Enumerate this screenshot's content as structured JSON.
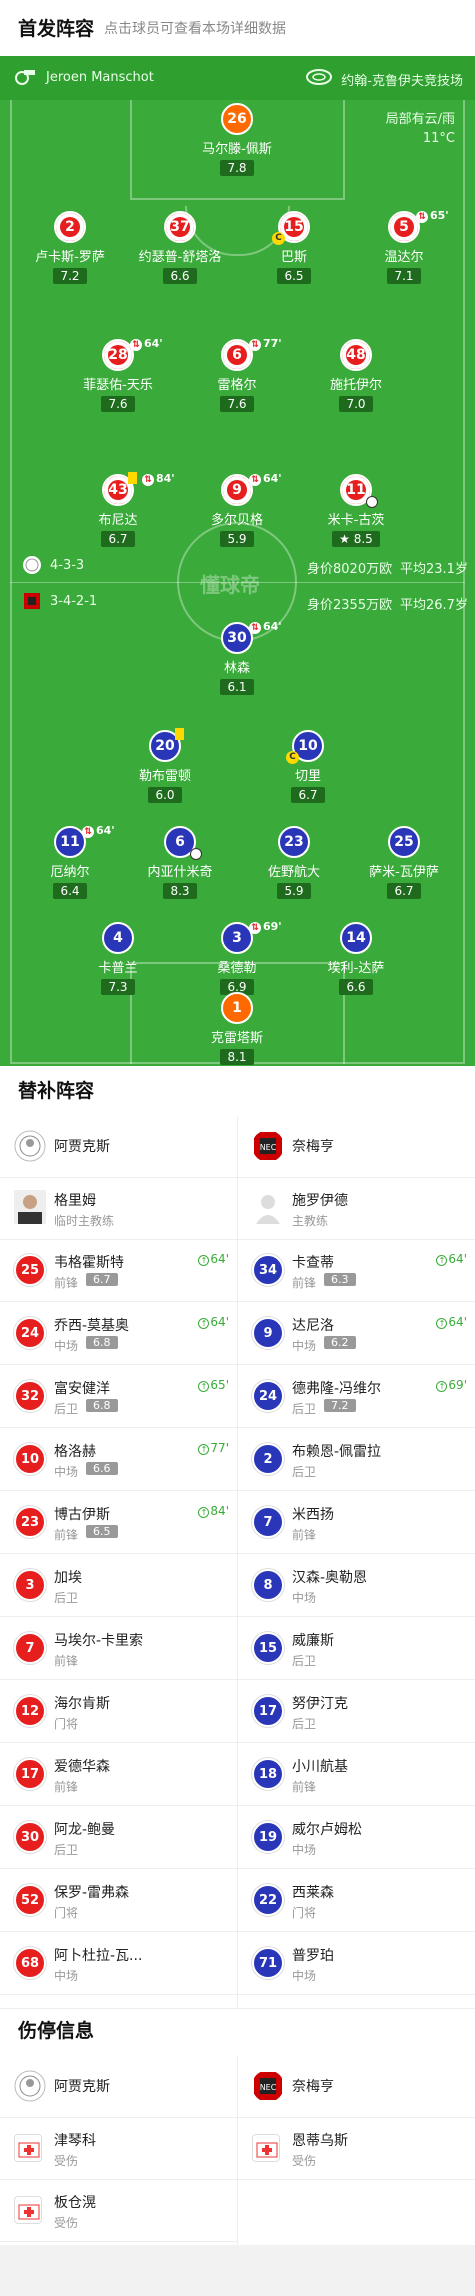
{
  "header": {
    "title": "首发阵容",
    "subtitle": "点击球员可查看本场详细数据"
  },
  "pitch": {
    "referee": "Jeroen Manschot",
    "venue": "约翰-克鲁伊夫竞技场",
    "weather": "局部有云/雨",
    "temperature": "11°C",
    "watermark": "懂球帝",
    "home": {
      "formation": "4-3-3",
      "value": "身价8020万欧",
      "age": "平均23.1岁"
    },
    "away": {
      "formation": "3-4-2-1",
      "value": "身价2355万欧",
      "age": "平均26.7岁"
    }
  },
  "home_players": [
    {
      "num": "26",
      "name": "马尔滕-佩斯",
      "rating": "7.8"
    },
    {
      "num": "2",
      "name": "卢卡斯-罗萨",
      "rating": "7.2"
    },
    {
      "num": "37",
      "name": "约瑟普-舒塔洛",
      "rating": "6.6"
    },
    {
      "num": "15",
      "name": "巴斯",
      "rating": "6.5"
    },
    {
      "num": "5",
      "name": "温达尔",
      "rating": "7.1",
      "sub": "65'"
    },
    {
      "num": "28",
      "name": "菲瑟佑-天乐",
      "rating": "7.6",
      "sub": "64'"
    },
    {
      "num": "6",
      "name": "雷格尔",
      "rating": "7.6",
      "sub": "77'"
    },
    {
      "num": "48",
      "name": "施托伊尔",
      "rating": "7.0"
    },
    {
      "num": "43",
      "name": "布尼达",
      "rating": "6.7",
      "sub": "84'"
    },
    {
      "num": "9",
      "name": "多尔贝格",
      "rating": "5.9",
      "sub": "64'"
    },
    {
      "num": "11",
      "name": "米卡-古茨",
      "rating": "8.5"
    }
  ],
  "away_players": [
    {
      "num": "30",
      "name": "林森",
      "rating": "6.1",
      "sub": "64'"
    },
    {
      "num": "20",
      "name": "勒布雷顿",
      "rating": "6.0"
    },
    {
      "num": "10",
      "name": "切里",
      "rating": "6.7"
    },
    {
      "num": "11",
      "name": "厄纳尔",
      "rating": "6.4",
      "sub": "64'"
    },
    {
      "num": "6",
      "name": "内亚什米奇",
      "rating": "8.3"
    },
    {
      "num": "23",
      "name": "佐野航大",
      "rating": "5.9"
    },
    {
      "num": "25",
      "name": "萨米-瓦伊萨",
      "rating": "6.7"
    },
    {
      "num": "4",
      "name": "卡普兰",
      "rating": "7.3"
    },
    {
      "num": "3",
      "name": "桑德勒",
      "rating": "6.9",
      "sub": "69'"
    },
    {
      "num": "14",
      "name": "埃利-达萨",
      "rating": "6.6"
    },
    {
      "num": "1",
      "name": "克雷塔斯",
      "rating": "8.1"
    }
  ],
  "subs": {
    "title": "替补阵容",
    "home_team": "阿贾克斯",
    "away_team": "奈梅亨",
    "home_coach": {
      "name": "格里姆",
      "role": "临时主教练"
    },
    "away_coach": {
      "name": "施罗伊德",
      "role": "主教练"
    },
    "home": [
      {
        "num": "25",
        "name": "韦格霍斯特",
        "pos": "前锋",
        "rating": "6.7",
        "sub": "64'"
      },
      {
        "num": "24",
        "name": "乔西-莫基奥",
        "pos": "中场",
        "rating": "6.8",
        "sub": "64'"
      },
      {
        "num": "32",
        "name": "富安健洋",
        "pos": "后卫",
        "rating": "6.8",
        "sub": "65'"
      },
      {
        "num": "10",
        "name": "格洛赫",
        "pos": "中场",
        "rating": "6.6",
        "sub": "77'"
      },
      {
        "num": "23",
        "name": "博古伊斯",
        "pos": "前锋",
        "rating": "6.5",
        "sub": "84'"
      },
      {
        "num": "3",
        "name": "加埃",
        "pos": "后卫"
      },
      {
        "num": "7",
        "name": "马埃尔-卡里索",
        "pos": "前锋"
      },
      {
        "num": "12",
        "name": "海尔肯斯",
        "pos": "门将"
      },
      {
        "num": "17",
        "name": "爱德华森",
        "pos": "前锋"
      },
      {
        "num": "30",
        "name": "阿龙-鲍曼",
        "pos": "后卫"
      },
      {
        "num": "52",
        "name": "保罗-雷弗森",
        "pos": "门将"
      },
      {
        "num": "68",
        "name": "阿卜杜拉-瓦...",
        "pos": "中场"
      }
    ],
    "away": [
      {
        "num": "34",
        "name": "卡查蒂",
        "pos": "前锋",
        "rating": "6.3",
        "sub": "64'"
      },
      {
        "num": "9",
        "name": "达尼洛",
        "pos": "中场",
        "rating": "6.2",
        "sub": "64'"
      },
      {
        "num": "24",
        "name": "德弗隆-冯维尔",
        "pos": "后卫",
        "rating": "7.2",
        "sub": "69'"
      },
      {
        "num": "2",
        "name": "布赖恩-佩雷拉",
        "pos": "后卫"
      },
      {
        "num": "7",
        "name": "米西扬",
        "pos": "前锋"
      },
      {
        "num": "8",
        "name": "汉森-奥勒恩",
        "pos": "中场"
      },
      {
        "num": "15",
        "name": "威廉斯",
        "pos": "后卫"
      },
      {
        "num": "17",
        "name": "努伊汀克",
        "pos": "后卫"
      },
      {
        "num": "18",
        "name": "小川航基",
        "pos": "前锋"
      },
      {
        "num": "19",
        "name": "威尔卢姆松",
        "pos": "中场"
      },
      {
        "num": "22",
        "name": "西莱森",
        "pos": "门将"
      },
      {
        "num": "71",
        "name": "普罗珀",
        "pos": "中场"
      }
    ]
  },
  "injury": {
    "title": "伤停信息",
    "home_team": "阿贾克斯",
    "away_team": "奈梅亨",
    "home": [
      {
        "name": "津琴科",
        "status": "受伤"
      },
      {
        "name": "板仓滉",
        "status": "受伤"
      }
    ],
    "away": [
      {
        "name": "恩蒂乌斯",
        "status": "受伤"
      }
    ]
  }
}
